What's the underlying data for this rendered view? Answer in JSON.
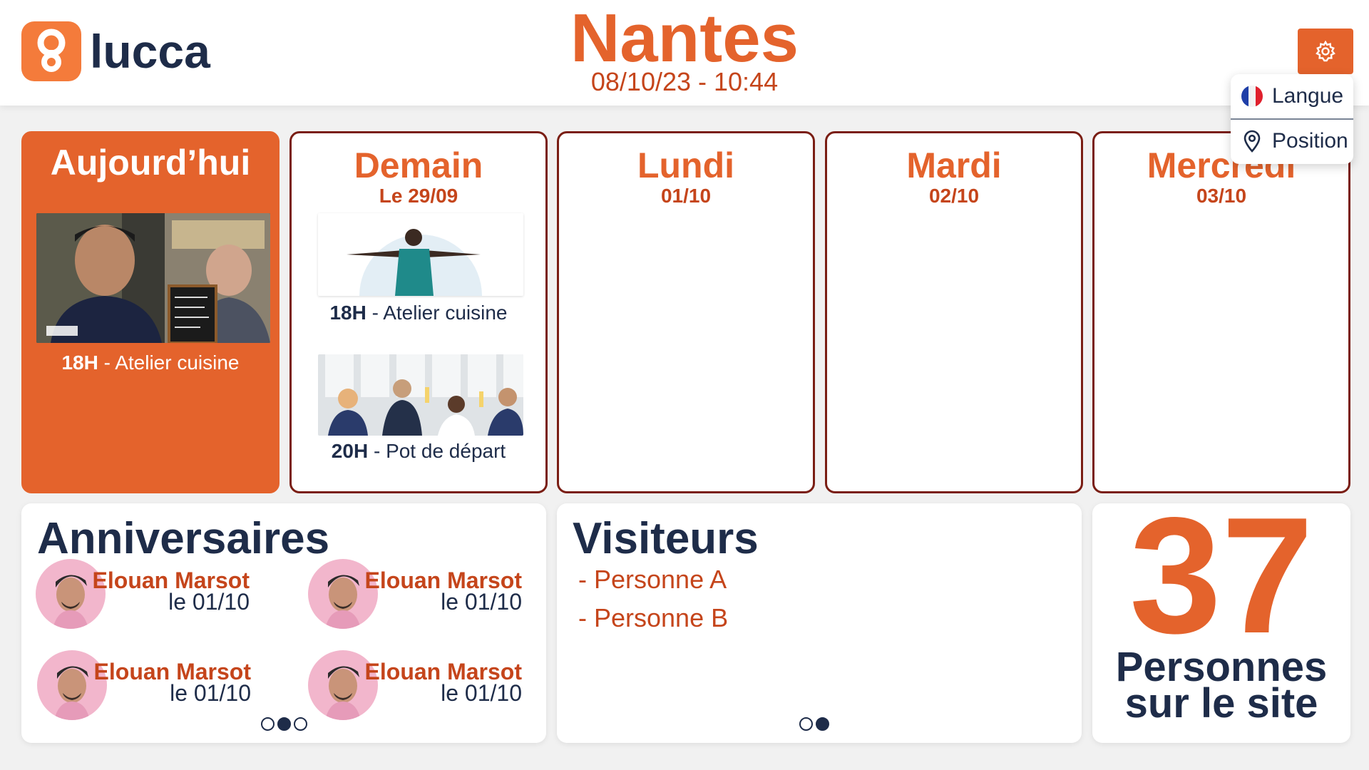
{
  "header": {
    "brand": "lucca",
    "city": "Nantes",
    "datetime": "08/10/23 - 10:44",
    "settings_icon": "gear-icon",
    "menu": [
      {
        "label": "Langue",
        "icon": "french-flag-icon"
      },
      {
        "label": "Position",
        "icon": "location-pin-icon"
      }
    ]
  },
  "days": [
    {
      "name": "Aujourd’hui",
      "date": "",
      "events": [
        {
          "time": "18H",
          "title": "Atelier cuisine"
        }
      ]
    },
    {
      "name": "Demain",
      "date": "Le 29/09",
      "events": [
        {
          "time": "18H",
          "title": "Atelier cuisine"
        },
        {
          "time": "20H",
          "title": "Pot de départ"
        }
      ]
    },
    {
      "name": "Lundi",
      "date": "01/10",
      "events": []
    },
    {
      "name": "Mardi",
      "date": "02/10",
      "events": []
    },
    {
      "name": "Mercredi",
      "date": "03/10",
      "events": []
    }
  ],
  "birthdays": {
    "title": "Anniversaires",
    "items": [
      {
        "name": "Elouan Marsot",
        "date": "le 01/10"
      },
      {
        "name": "Elouan Marsot",
        "date": "le 01/10"
      },
      {
        "name": "Elouan Marsot",
        "date": "le 01/10"
      },
      {
        "name": "Elouan Marsot",
        "date": "le 01/10"
      }
    ],
    "pages": 3,
    "active_page": 2
  },
  "visitors": {
    "title": "Visiteurs",
    "items": [
      "- Personne A",
      "- Personne B"
    ],
    "pages": 2,
    "active_page": 2
  },
  "occupancy": {
    "count": "37",
    "label_line1": "Personnes",
    "label_line2": "sur le site"
  },
  "colors": {
    "accent": "#e4632c",
    "accent_dark": "#c5451b",
    "navy": "#1e2c49",
    "border": "#7a1e14"
  }
}
